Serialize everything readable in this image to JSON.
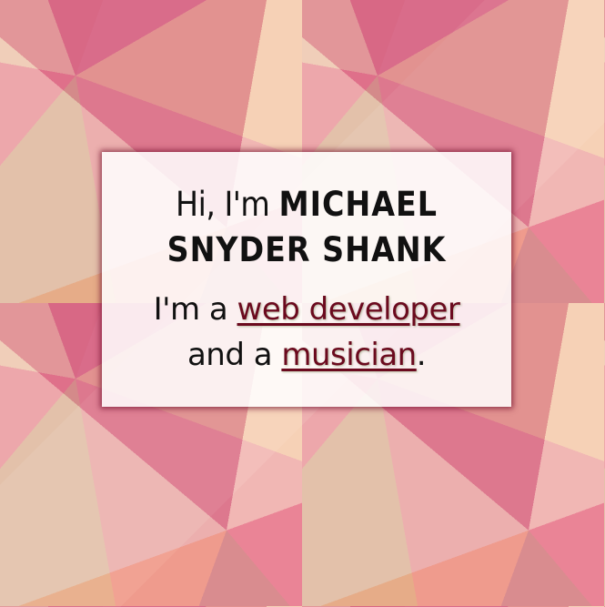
{
  "intro": {
    "greeting": "Hi, I'm",
    "name_line1": "Michael",
    "name_line2": "Snyder Shank"
  },
  "tagline": {
    "prefix": "I'm a",
    "link1": "web developer",
    "middle": "and a",
    "link2": "musician",
    "suffix": "."
  },
  "colors": {
    "link": "#6b0a1e",
    "card_shadow": "#6e0a28"
  }
}
